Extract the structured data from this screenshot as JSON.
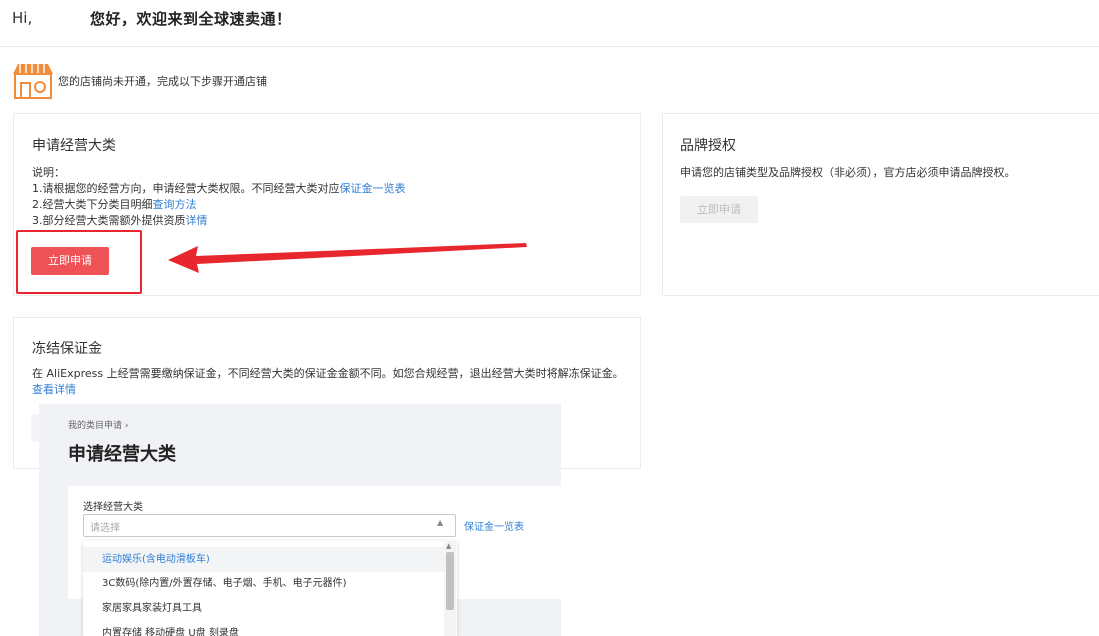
{
  "header": {
    "hi": "Hi,",
    "greeting": "您好，欢迎来到全球速卖通！"
  },
  "store_notice": "您的店铺尚未开通，完成以下步骤开通店铺",
  "category_card": {
    "title": "申请经营大类",
    "desc_intro": "说明：",
    "line1": "1.请根据您的经营方向，申请经营大类权限。不同经营大类对应",
    "line1_link": "保证金一览表",
    "line2": "2.经营大类下分类目明细",
    "line2_link": "查询方法",
    "line3": "3.部分经营大类需额外提供资质",
    "line3_link": "详情",
    "apply_button": "立即申请"
  },
  "brand_card": {
    "title": "品牌授权",
    "desc": "申请您的店铺类型及品牌授权（非必须），官方店必须申请品牌授权。",
    "apply_button": "立即申请"
  },
  "deposit_card": {
    "title": "冻结保证金",
    "desc": "在 AliExpress 上经营需要缴纳保证金，不同经营大类的保证金金额不同。如您合规经营，退出经营大类时将解冻保证金。",
    "link": "查看详情"
  },
  "overlay": {
    "breadcrumb": "我的类目申请 ›",
    "title": "申请经营大类",
    "field_label": "选择经营大类",
    "placeholder": "请选择",
    "deposit_link": "保证金一览表",
    "options": [
      "运动娱乐(含电动滑板车)",
      "3C数码(除内置/外置存储、电子烟、手机、电子元器件)",
      "家居家具家装灯具工具",
      "内置存储 移动硬盘 U盘 刻录盘"
    ]
  },
  "colors": {
    "primary_red": "#ee5256",
    "highlight_red": "#e8262d",
    "link_blue": "#2f7fd6",
    "store_icon_orange": "#f08c3a"
  },
  "icons": {
    "store": "store-icon",
    "annotation_arrow": "arrow-left-icon"
  }
}
